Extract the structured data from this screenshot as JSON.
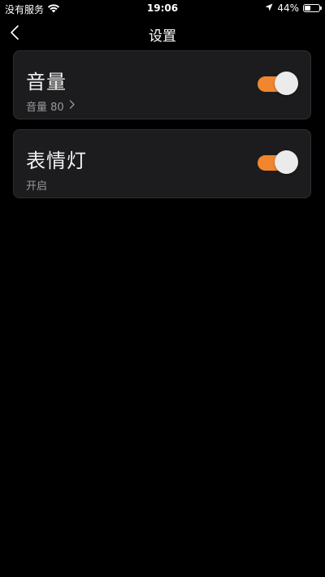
{
  "status_bar": {
    "carrier": "没有服务",
    "time": "19:06",
    "battery_text": "44%",
    "battery_level": 0.44
  },
  "nav": {
    "title": "设置"
  },
  "cards": [
    {
      "title": "音量",
      "subtitle": "音量 80",
      "enabled": true
    },
    {
      "title": "表情灯",
      "subtitle": "开启",
      "enabled": true
    }
  ],
  "colors": {
    "toggle_on": "#f0862d",
    "card_bg": "#1c1c1e",
    "page_bg": "#000000"
  },
  "icons": {
    "wifi": "wifi-icon",
    "location": "location-arrow-icon",
    "battery": "battery-icon",
    "back": "chevron-left-icon",
    "subtitle_arrow": "chevron-right-icon"
  }
}
